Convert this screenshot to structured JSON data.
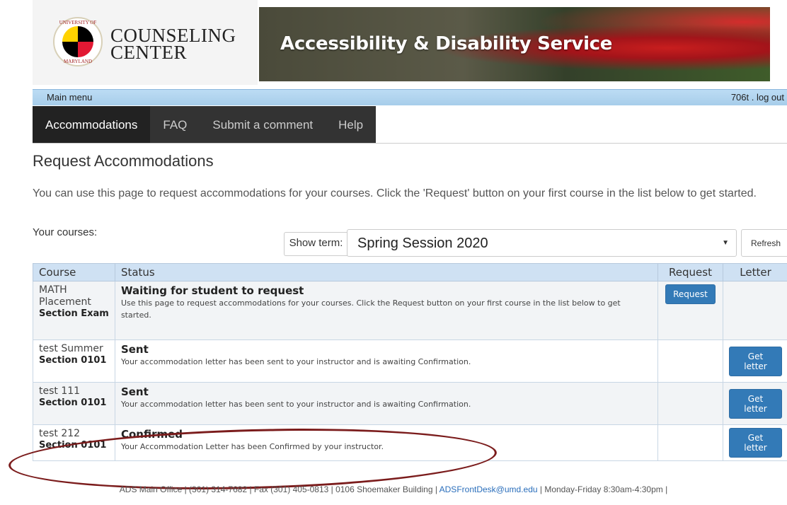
{
  "header": {
    "seal_top_text": "UNIVERSITY OF",
    "seal_bottom_text": "MARYLAND",
    "logo_line1": "COUNSELING",
    "logo_line2": "CENTER",
    "banner_title": "Accessibility & Disability Service"
  },
  "menubar": {
    "left_label": "Main menu",
    "right_label": "706t . log out"
  },
  "tabs": [
    {
      "label": "Accommodations",
      "active": true
    },
    {
      "label": "FAQ",
      "active": false
    },
    {
      "label": "Submit a comment",
      "active": false
    },
    {
      "label": "Help",
      "active": false
    }
  ],
  "page": {
    "title": "Request Accommodations",
    "intro": "You can use this page to request accommodations for your courses. Click the 'Request' button on your first course in the list below to get started.",
    "courses_label": "Your courses:"
  },
  "term": {
    "label": "Show term:",
    "selected": "Spring Session 2020",
    "refresh_label": "Refresh"
  },
  "table": {
    "headers": {
      "course": "Course",
      "status": "Status",
      "request": "Request",
      "letter": "Letter"
    },
    "rows": [
      {
        "course": "MATH Placement",
        "section": "Section Exam",
        "status_title": "Waiting for student to request",
        "status_desc": "Use this page to request accommodations for your courses. Click the Request button on your first course in the list below to get started.",
        "request_button": "Request",
        "letter_button": ""
      },
      {
        "course": "test Summer",
        "section": "Section 0101",
        "status_title": "Sent",
        "status_desc": "Your accommodation letter has been sent to your instructor and is awaiting Confirmation.",
        "request_button": "",
        "letter_button": "Get letter"
      },
      {
        "course": "test 111",
        "section": "Section 0101",
        "status_title": "Sent",
        "status_desc": "Your accommodation letter has been sent to your instructor and is awaiting Confirmation.",
        "request_button": "",
        "letter_button": "Get letter"
      },
      {
        "course": "test 212",
        "section": "Section 0101",
        "status_title": "Confirmed",
        "status_desc": "Your Accommodation Letter has been Confirmed by your instructor.",
        "request_button": "",
        "letter_button": "Get letter"
      }
    ]
  },
  "footer": {
    "prefix": "ADS Main Office | (301) 314-7682 | Fax (301) 405-0813 | 0106 Shoemaker Building | ",
    "email": "ADSFrontDesk@umd.edu",
    "suffix": " | Monday-Friday 8:30am-4:30pm |"
  },
  "colors": {
    "accent": "#337ab7",
    "menubar": "#a7cdea",
    "tabbar": "#333333",
    "annotation": "#7b1c1c"
  }
}
